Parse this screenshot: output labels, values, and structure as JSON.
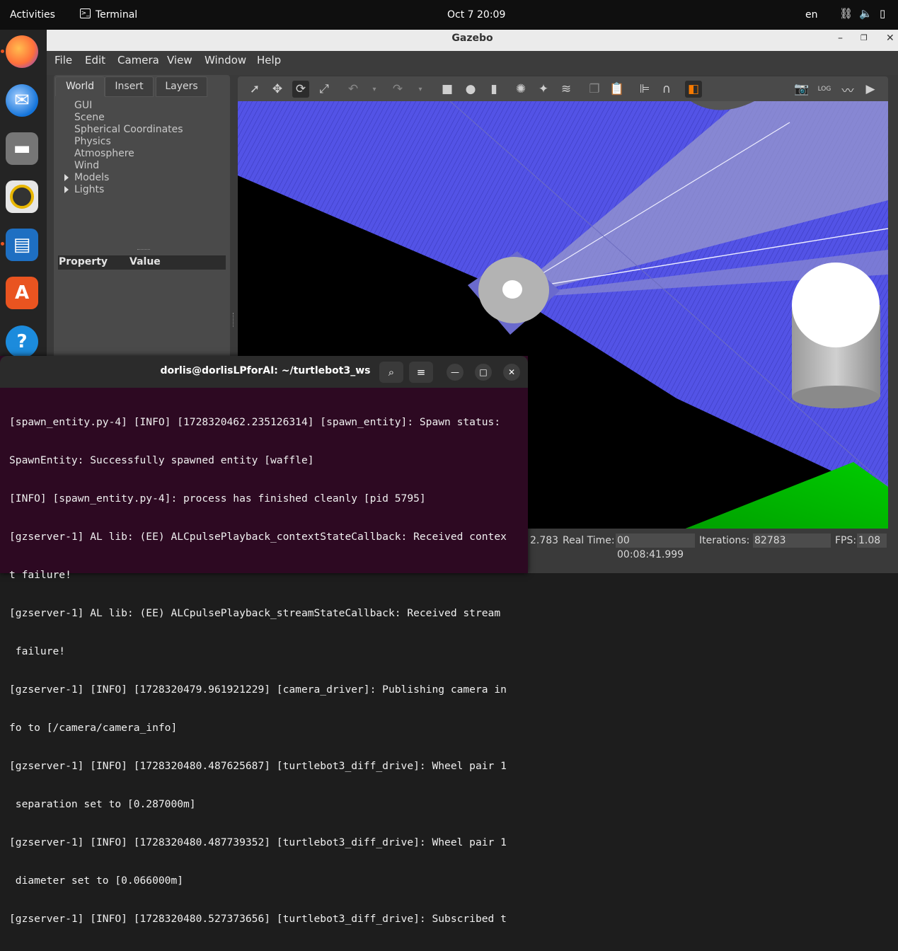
{
  "topbar": {
    "activities": "Activities",
    "app": "Terminal",
    "clock": "Oct 7  20:09",
    "lang": "en"
  },
  "dock": {
    "icons": [
      "firefox-icon",
      "thunderbird-icon",
      "files-icon",
      "rhythmbox-icon",
      "writer-icon",
      "app-center-icon",
      "help-icon",
      "layers-icon",
      "terminal-icon",
      "trash-icon",
      "apps-grid-icon"
    ]
  },
  "gazebo": {
    "title": "Gazebo",
    "menu": [
      "File",
      "Edit",
      "Camera",
      "View",
      "Window",
      "Help"
    ],
    "tabs": [
      "World",
      "Insert",
      "Layers"
    ],
    "tree": [
      "GUI",
      "Scene",
      "Spherical Coordinates",
      "Physics",
      "Atmosphere",
      "Wind",
      "Models",
      "Lights"
    ],
    "prop_header": {
      "property": "Property",
      "value": "Value"
    },
    "status": {
      "sim_time_tail": "2.783",
      "real_time_label": "Real Time:",
      "real_time": "00 00:08:41.999",
      "iterations_label": "Iterations:",
      "iterations": "82783",
      "fps_label": "FPS:",
      "fps": "1.08"
    }
  },
  "terminal": {
    "title": "dorlis@dorlisLPforAI: ~/turtlebot3_ws",
    "lines": [
      "[spawn_entity.py-4] [INFO] [1728320462.235126314] [spawn_entity]: Spawn status:",
      "SpawnEntity: Successfully spawned entity [waffle]",
      "[INFO] [spawn_entity.py-4]: process has finished cleanly [pid 5795]",
      "[gzserver-1] AL lib: (EE) ALCpulsePlayback_contextStateCallback: Received contex",
      "t failure!",
      "[gzserver-1] AL lib: (EE) ALCpulsePlayback_streamStateCallback: Received stream",
      " failure!",
      "[gzserver-1] [INFO] [1728320479.961921229] [camera_driver]: Publishing camera in",
      "fo to [/camera/camera_info]",
      "[gzserver-1] [INFO] [1728320480.487625687] [turtlebot3_diff_drive]: Wheel pair 1",
      " separation set to [0.287000m]",
      "[gzserver-1] [INFO] [1728320480.487739352] [turtlebot3_diff_drive]: Wheel pair 1",
      " diameter set to [0.066000m]",
      "[gzserver-1] [INFO] [1728320480.527373656] [turtlebot3_diff_drive]: Subscribed t"
    ]
  }
}
